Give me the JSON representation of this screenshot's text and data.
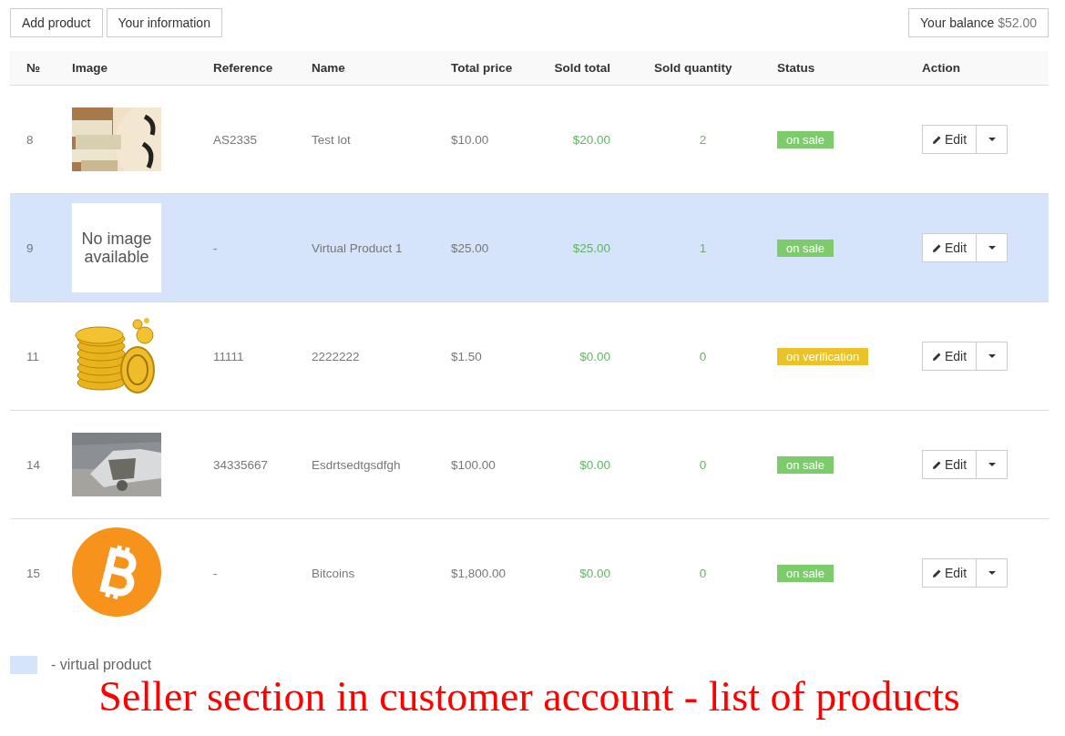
{
  "toolbar": {
    "buttons": [
      "Add product",
      "Your information"
    ],
    "balance": {
      "label": "Your balance",
      "amount": "$52.00"
    }
  },
  "table": {
    "columns": [
      "№",
      "Image",
      "Reference",
      "Name",
      "Total price",
      "Sold total",
      "Sold quantity",
      "Status",
      "Action"
    ],
    "rows": [
      {
        "number": "8",
        "reference": "AS2335",
        "name": "Test lot",
        "total_price": "$10.00",
        "sold_total": "$20.00",
        "sold_quantity": "2",
        "status": {
          "label": "on sale",
          "color": "#7ccc6c"
        },
        "virtual": false,
        "action": "Edit"
      },
      {
        "number": "9",
        "image": {
          "kind": "placeholder",
          "text": "No image available"
        },
        "reference": "-",
        "name": "Virtual Product 1",
        "total_price": "$25.00",
        "sold_total": "$25.00",
        "sold_quantity": "1",
        "status": {
          "label": "on sale",
          "color": "#7ccc6c"
        },
        "virtual": true,
        "action": "Edit"
      },
      {
        "number": "11",
        "image": {
          "kind": "coins"
        },
        "reference": "11111",
        "name": "2222222",
        "total_price": "$1.50",
        "sold_total": "$0.00",
        "sold_quantity": "0",
        "status": {
          "label": "on verification",
          "color": "#ecc22a"
        },
        "virtual": false,
        "action": "Edit"
      },
      {
        "number": "14",
        "reference": "34335667",
        "name": "Esdrtsedtgsdfgh",
        "total_price": "$100.00",
        "sold_total": "$0.00",
        "sold_quantity": "0",
        "status": {
          "label": "on sale",
          "color": "#7ccc6c"
        },
        "virtual": false,
        "action": "Edit"
      },
      {
        "number": "15",
        "image": {
          "kind": "bitcoin"
        },
        "reference": "-",
        "name": "Bitcoins",
        "total_price": "$1,800.00",
        "sold_total": "$0.00",
        "sold_quantity": "0",
        "status": {
          "label": "on sale",
          "color": "#7ccc6c"
        },
        "virtual": false,
        "action": "Edit"
      }
    ]
  },
  "legend": {
    "text": "- virtual product"
  },
  "caption": "Seller section in customer account - list of products"
}
